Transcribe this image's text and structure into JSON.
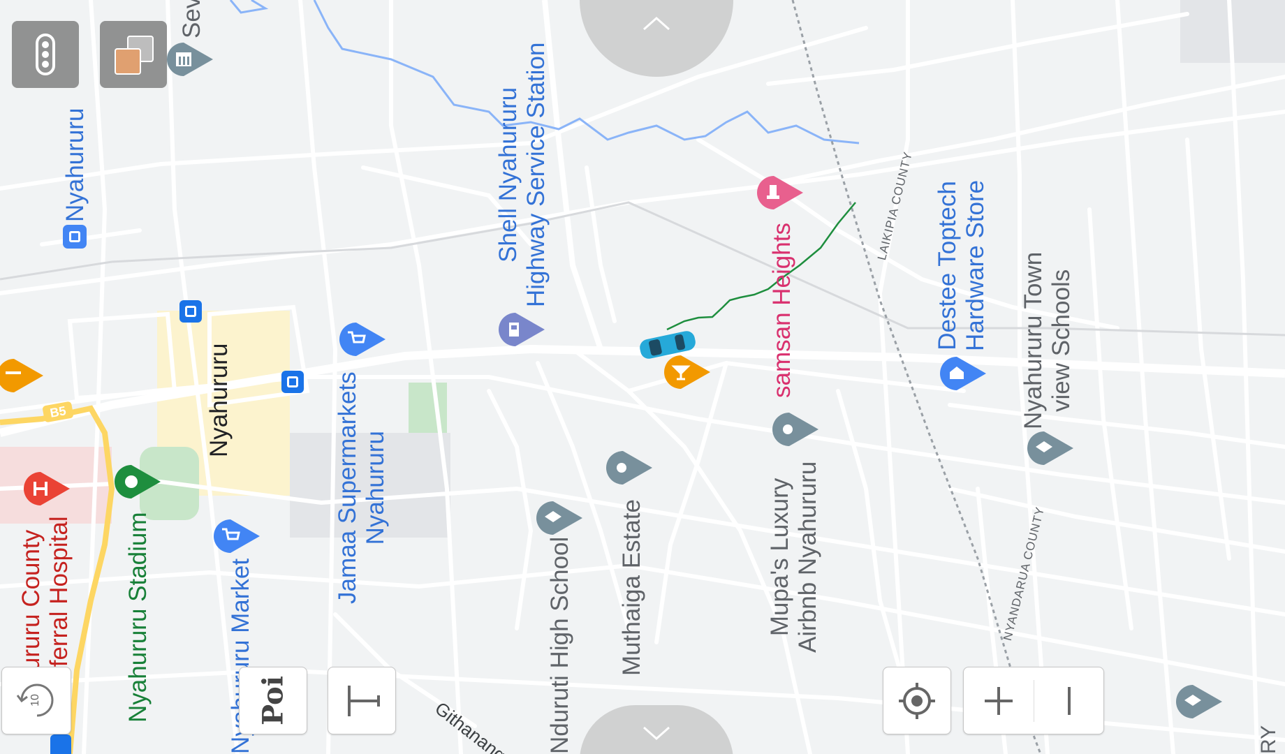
{
  "map": {
    "labels": {
      "nyahururu_top": "Nyahururu",
      "sev": "Sev",
      "shell": [
        "Shell Nyahururu",
        "Highway Service Station"
      ],
      "samsan": "samsan Heights",
      "destee": [
        "Destee Toptech",
        "Hardware Store"
      ],
      "nyahururu_town": [
        "Nyahururu Town",
        "view Schools"
      ],
      "nyahururu_black": "Nyahururu",
      "jamaa": [
        "Jamaa Supermarkets",
        "Nyahururu"
      ],
      "market": "Nyahururu Market",
      "stadium": "Nyahururu Stadium",
      "hospital": [
        "hururu County",
        "Referral Hospital"
      ],
      "high_school": "Nduruti High School",
      "muthaiga": "Muthaiga Estate",
      "mupas": [
        "Mupa's Luxury",
        "Airbnb Nyahururu"
      ],
      "laikipia": "LAIKIPIA COUNTY",
      "nyandarua": "NYANDARUA COUNTY",
      "road": "Githanange Rd",
      "route_shield": "B5",
      "partial_ry": "RY"
    },
    "icons": [
      "museum-icon",
      "bus-stop-icon",
      "fuel-station-icon",
      "shopping-cart-icon",
      "hospital-icon",
      "stadium-icon",
      "school-icon",
      "place-pin-icon",
      "cocktail-bar-icon",
      "hardware-store-icon",
      "car-location-icon"
    ]
  },
  "controls": {
    "traffic": "traffic-layer-icon",
    "layers": "layers-icon",
    "rotate_label": "10",
    "poi_label": "Poi",
    "text_label": "T",
    "locate": "my-location-icon",
    "zoom_in": "+",
    "zoom_out": "−"
  },
  "colors": {
    "background": "#f1f3f4",
    "road": "#ffffff",
    "water": "#8ab4f8",
    "park": "#c8e6c9",
    "route_yellow": "#fdd663",
    "track": "#1e8e3e",
    "blue_label": "#3372d6",
    "pink_label": "#d9306e"
  }
}
